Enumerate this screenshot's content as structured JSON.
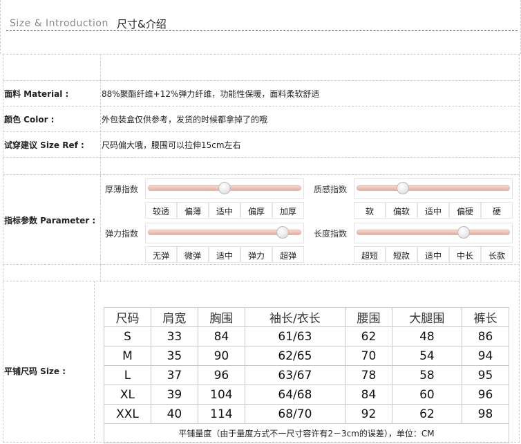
{
  "header": {
    "title_en": "Size & Introduction",
    "title_cn": "尺寸&介绍"
  },
  "rows": {
    "material": {
      "label": "面料 Material :",
      "value": "88%聚酯纤维+12%弹力纤维，功能性保暖，面料柔软舒适"
    },
    "color": {
      "label": "颜色 Color :",
      "value": "外包装盒仅供参考，发货的时候都拿掉了的哦"
    },
    "size_ref": {
      "label": "试穿建议 Size Ref :",
      "value": "尺码偏大哦，腰围可以拉伸15cm左右"
    },
    "parameter": {
      "label": "指标参数 Parameter :"
    },
    "size": {
      "label": "平铺尺码 Size :"
    }
  },
  "parameters": [
    {
      "name": "厚薄指数",
      "options": [
        "较透",
        "偏薄",
        "适中",
        "偏厚",
        "加厚"
      ],
      "level": 0.5
    },
    {
      "name": "质感指数",
      "options": [
        "软",
        "偏软",
        "适中",
        "偏硬",
        "硬"
      ],
      "level": 0.3
    },
    {
      "name": "弹力指数",
      "options": [
        "无弹",
        "微弹",
        "适中",
        "弹力",
        "超弹"
      ],
      "level": 0.88
    },
    {
      "name": "长度指数",
      "options": [
        "超短",
        "短款",
        "适中",
        "中长",
        "长款"
      ],
      "level": 0.7
    }
  ],
  "size_table": {
    "headers": [
      "尺码",
      "肩宽",
      "胸围",
      "袖长/衣长",
      "腰围",
      "大腿围",
      "裤长"
    ],
    "rows": [
      [
        "S",
        "33",
        "84",
        "61/63",
        "62",
        "48",
        "86"
      ],
      [
        "M",
        "35",
        "90",
        "62/65",
        "70",
        "54",
        "94"
      ],
      [
        "L",
        "37",
        "96",
        "63/67",
        "78",
        "58",
        "95"
      ],
      [
        "XL",
        "39",
        "104",
        "64/68",
        "84",
        "60",
        "96"
      ],
      [
        "XXL",
        "40",
        "114",
        "68/70",
        "92",
        "62",
        "98"
      ]
    ],
    "note": "平铺量度（由于量度方式不一尺寸容许有2－3cm的误差），单位：CM"
  },
  "colors": {
    "track": "#e8b8aa",
    "border": "#cccccc"
  }
}
